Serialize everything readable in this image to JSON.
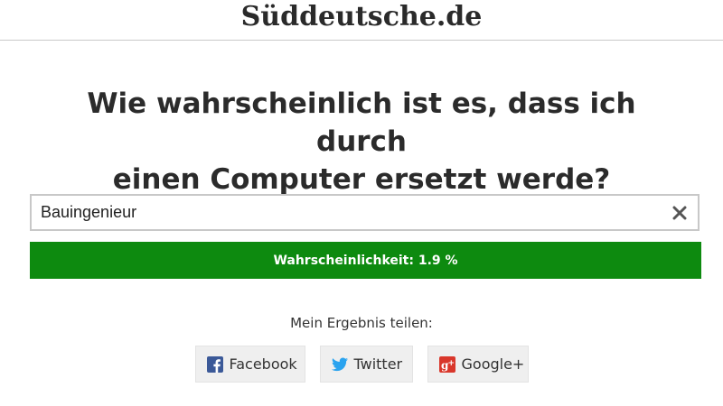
{
  "header": {
    "logo_text": "Süddeutsche.de"
  },
  "main": {
    "headline_line1": "Wie wahrscheinlich ist es, dass ich durch",
    "headline_line2": "einen Computer ersetzt werde?"
  },
  "search": {
    "value": "Bauingenieur",
    "clear_icon": "close-icon"
  },
  "result": {
    "label": "Wahrscheinlichkeit: 1.9 %",
    "probability_percent": 1.9,
    "bar_color": "#0d8a0f"
  },
  "share": {
    "label": "Mein Ergebnis teilen:",
    "buttons": [
      {
        "label": "Facebook",
        "icon": "facebook-icon",
        "color": "#3b5998"
      },
      {
        "label": "Twitter",
        "icon": "twitter-icon",
        "color": "#2aa3ef"
      },
      {
        "label": "Google+",
        "icon": "google-plus-icon",
        "color": "#d9372b"
      }
    ]
  }
}
